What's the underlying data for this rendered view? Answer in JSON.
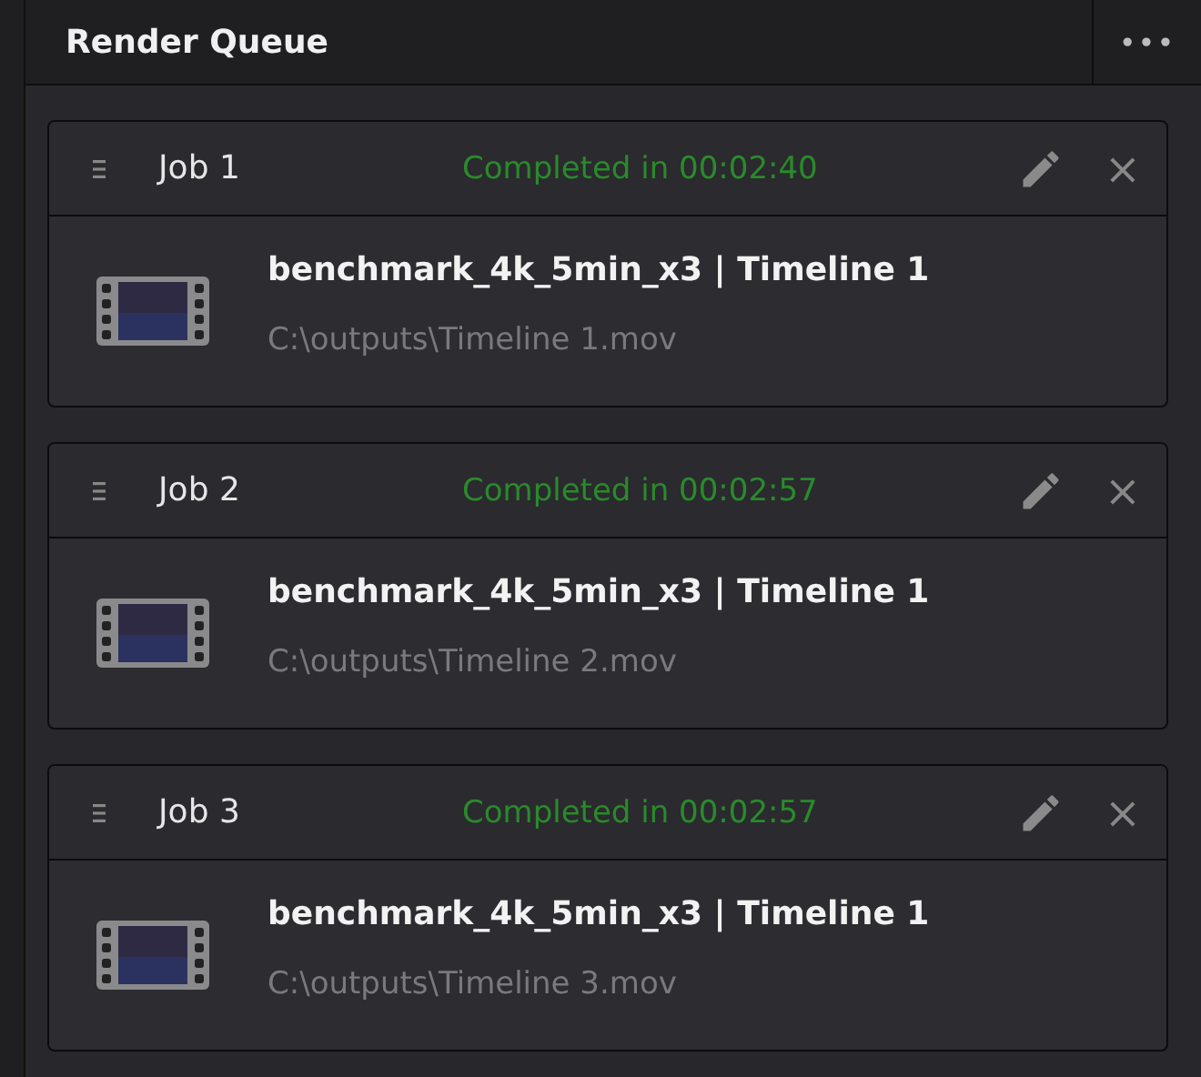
{
  "panel": {
    "title": "Render Queue",
    "menu": "•••"
  },
  "jobs": [
    {
      "name": "Job 1",
      "status": "Completed in 00:02:40",
      "title": "benchmark_4k_5min_x3 | Timeline 1",
      "path": "C:\\outputs\\Timeline 1.mov",
      "close": "×"
    },
    {
      "name": "Job 2",
      "status": "Completed in 00:02:57",
      "title": "benchmark_4k_5min_x3 | Timeline 1",
      "path": "C:\\outputs\\Timeline 2.mov",
      "close": "×"
    },
    {
      "name": "Job 3",
      "status": "Completed in 00:02:57",
      "title": "benchmark_4k_5min_x3 | Timeline 1",
      "path": "C:\\outputs\\Timeline 3.mov",
      "close": "×"
    }
  ]
}
